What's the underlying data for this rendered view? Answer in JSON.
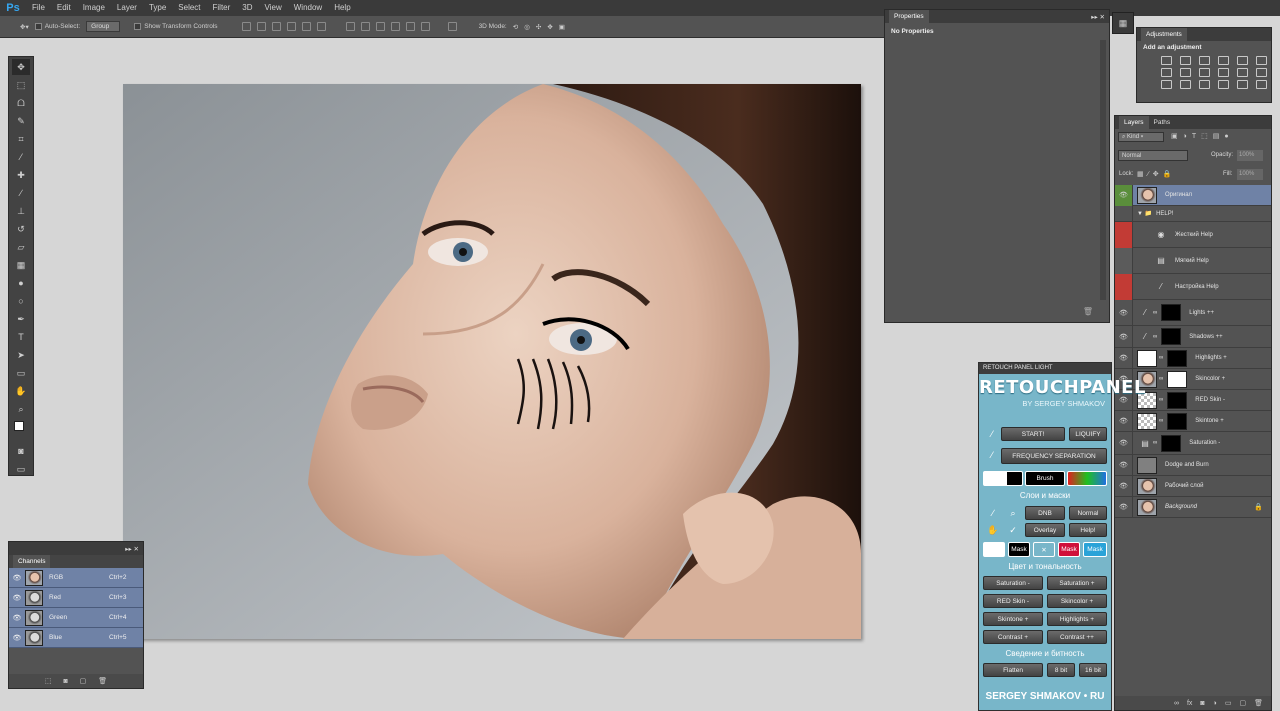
{
  "app": {
    "logo": "Ps"
  },
  "menu": [
    "File",
    "Edit",
    "Image",
    "Layer",
    "Type",
    "Select",
    "Filter",
    "3D",
    "View",
    "Window",
    "Help"
  ],
  "options": {
    "auto_select_label": "Auto-Select:",
    "auto_select_value": "Group",
    "transform_label": "Show Transform Controls",
    "mode_label": "3D Mode:"
  },
  "properties": {
    "tab": "Properties",
    "message": "No Properties"
  },
  "adjustments": {
    "tab": "Adjustments",
    "heading": "Add an adjustment"
  },
  "layers": {
    "tabs": [
      "Layers",
      "Paths"
    ],
    "kind": "Kind",
    "blend_mode": "Normal",
    "opacity_label": "Opacity:",
    "opacity_value": "100%",
    "lock_label": "Lock:",
    "fill_label": "Fill:",
    "fill_value": "100%",
    "items": [
      {
        "name": "Оригинал"
      },
      {
        "name": "HELP!"
      },
      {
        "name": "Жесткий Help"
      },
      {
        "name": "Мягкий Help"
      },
      {
        "name": "Настройка Help"
      },
      {
        "name": "Lights ++"
      },
      {
        "name": "Shadows ++"
      },
      {
        "name": "Highlights +"
      },
      {
        "name": "Skincolor +"
      },
      {
        "name": "RED Skin -"
      },
      {
        "name": "Skintone +"
      },
      {
        "name": "Saturation -"
      },
      {
        "name": "Dodge and Burn"
      },
      {
        "name": "Рабочий слой"
      },
      {
        "name": "Background"
      }
    ]
  },
  "channels": {
    "tab": "Channels",
    "items": [
      {
        "name": "RGB",
        "shortcut": "Ctrl+2"
      },
      {
        "name": "Red",
        "shortcut": "Ctrl+3"
      },
      {
        "name": "Green",
        "shortcut": "Ctrl+4"
      },
      {
        "name": "Blue",
        "shortcut": "Ctrl+5"
      }
    ]
  },
  "retouch": {
    "header": "RETOUCH PANEL LIGHT",
    "title": "RETOUCHPANEL",
    "subtitle": "BY SERGEY SHMAKOV",
    "start": "START!",
    "liquify": "LIQUIFY",
    "freq_sep": "FREQUENCY SEPARATION",
    "brush": "Brush",
    "layers_masks": "Слои и маски",
    "dnb": "DNB",
    "normal": "Normal",
    "overlay": "Overlay",
    "help": "Help!",
    "mask": "Mask",
    "color_tone": "Цвет и тональность",
    "saturation_minus": "Saturation -",
    "saturation_plus": "Saturation +",
    "redskin_minus": "RED Skin -",
    "skincolor_plus": "Skincolor +",
    "skintone_plus": "Skintone +",
    "highlights_plus": "Highlights +",
    "contrast_plus": "Contrast +",
    "contrast_plusplus": "Contrast ++",
    "flatten_section": "Сведение и битность",
    "flatten": "Flatten",
    "bit8": "8 bit",
    "bit16": "16 bit",
    "footer": "SERGEY SHMAKOV • RU"
  }
}
